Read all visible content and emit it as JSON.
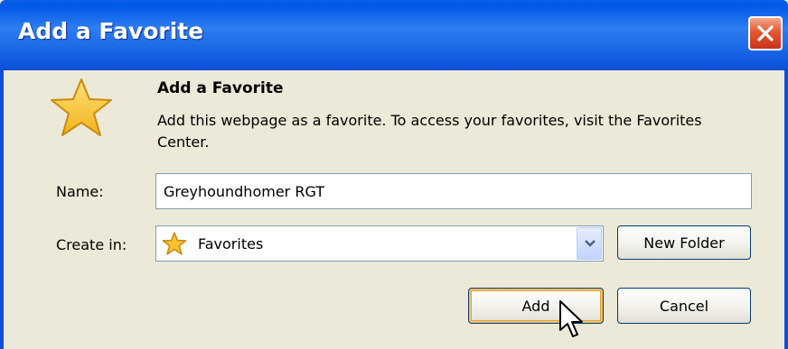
{
  "dialog": {
    "title": "Add a Favorite",
    "heading": "Add a Favorite",
    "description": "Add this webpage as a favorite. To access your favorites, visit the Favorites Center.",
    "name_label": "Name:",
    "name_value": "Greyhoundhomer RGT",
    "create_in_label": "Create in:",
    "create_in_value": "Favorites",
    "buttons": {
      "new_folder": "New Folder",
      "add": "Add",
      "cancel": "Cancel"
    },
    "icons": {
      "close": "close-icon",
      "favorite_star": "star-icon",
      "folder_star": "star-icon",
      "dropdown": "chevron-down-icon",
      "cursor": "mouse-pointer-icon"
    },
    "colors": {
      "titlebar": "#0058e6",
      "dialog_bg": "#ece9d8",
      "close_button": "#e5572f",
      "star": "#f7c52b"
    }
  }
}
